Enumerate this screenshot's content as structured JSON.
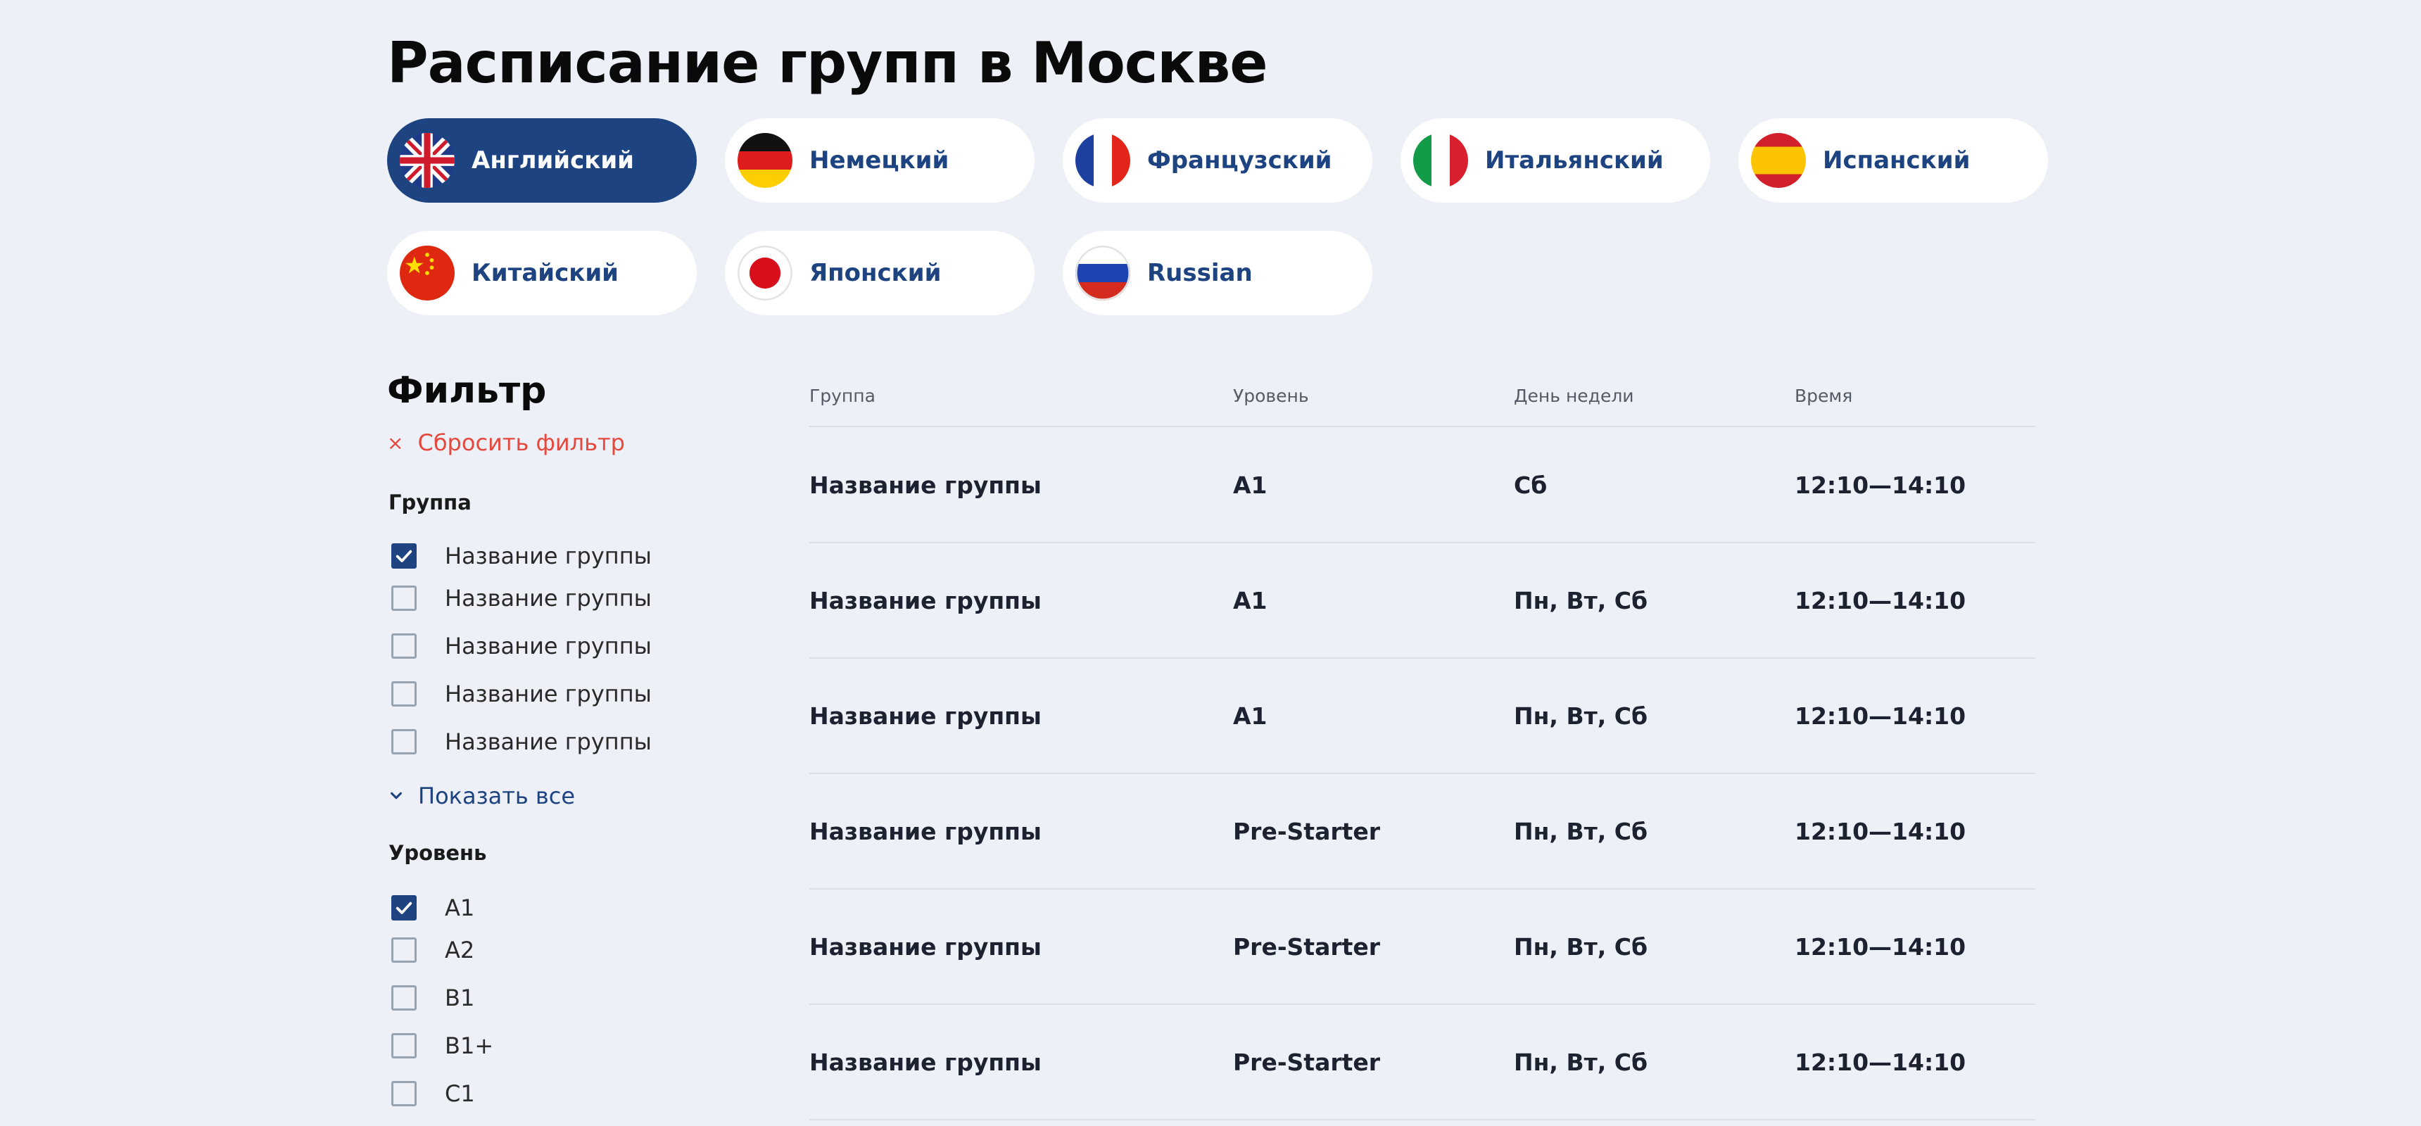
{
  "page_title": "Расписание групп в Москве",
  "languages": [
    {
      "label": "Английский",
      "flag": "uk-flag-icon",
      "active": true
    },
    {
      "label": "Немецкий",
      "flag": "germany-flag-icon",
      "active": false
    },
    {
      "label": "Французский",
      "flag": "france-flag-icon",
      "active": false
    },
    {
      "label": "Итальянский",
      "flag": "italy-flag-icon",
      "active": false
    },
    {
      "label": "Испанский",
      "flag": "spain-flag-icon",
      "active": false
    },
    {
      "label": "Китайский",
      "flag": "china-flag-icon",
      "active": false
    },
    {
      "label": "Японский",
      "flag": "japan-flag-icon",
      "active": false
    },
    {
      "label": "Russian",
      "flag": "russia-flag-icon",
      "active": false
    }
  ],
  "filter": {
    "title": "Фильтр",
    "reset_icon": "×",
    "reset_label": "Сбросить фильтр",
    "group_heading": "Группа",
    "group_options": [
      {
        "label": "Название группы",
        "checked": true
      },
      {
        "label": "Название группы",
        "checked": false
      },
      {
        "label": "Название группы",
        "checked": false
      },
      {
        "label": "Название группы",
        "checked": false
      },
      {
        "label": "Название группы",
        "checked": false
      }
    ],
    "show_all_label": "Показать все",
    "level_heading": "Уровень",
    "level_options": [
      {
        "label": "A1",
        "checked": true
      },
      {
        "label": "A2",
        "checked": false
      },
      {
        "label": "B1",
        "checked": false
      },
      {
        "label": "B1+",
        "checked": false
      },
      {
        "label": "C1",
        "checked": false
      }
    ]
  },
  "table": {
    "headers": [
      "Группа",
      "Уровень",
      "День недели",
      "Время"
    ],
    "rows": [
      [
        "Название группы",
        "A1",
        "Сб",
        "12:10—14:10"
      ],
      [
        "Название группы",
        "A1",
        "Пн, Вт, Сб",
        "12:10—14:10"
      ],
      [
        "Название группы",
        "A1",
        "Пн, Вт, Сб",
        "12:10—14:10"
      ],
      [
        "Название группы",
        "Pre-Starter",
        "Пн, Вт, Сб",
        "12:10—14:10"
      ],
      [
        "Название группы",
        "Pre-Starter",
        "Пн, Вт, Сб",
        "12:10—14:10"
      ],
      [
        "Название группы",
        "Pre-Starter",
        "Пн, Вт, Сб",
        "12:10—14:10"
      ]
    ]
  },
  "colors": {
    "background": "#edf0f7",
    "accent": "#1d4380",
    "reset": "#e5483c"
  }
}
